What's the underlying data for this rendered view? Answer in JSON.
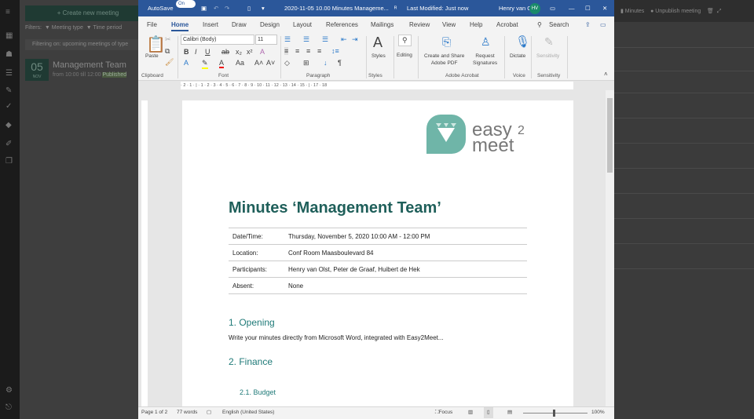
{
  "background_app": {
    "create_button": "+ Create new meeting",
    "filters_label": "Filters:",
    "filter_meeting_type": "▼ Meeting type",
    "filter_time_period": "▼ Time period",
    "filter_info": "Filtering on: upcoming meetings of type",
    "meeting": {
      "day": "05",
      "month": "NOV",
      "title": "Management Team",
      "subtitle": "from 10:00 till 12:00",
      "status": "Published"
    },
    "minutes_button": "Minutes",
    "unpublish_button": "Unpublish meeting"
  },
  "word": {
    "autosave": "AutoSave",
    "autosave_state": "On",
    "doc_title": "2020-11-05 10.00 Minutes Manageme...",
    "last_modified": "Last Modified: Just now",
    "user": "Henry van Olst",
    "initials": "HV",
    "tabs": [
      "File",
      "Home",
      "Insert",
      "Draw",
      "Design",
      "Layout",
      "References",
      "Mailings",
      "Review",
      "View",
      "Help",
      "Acrobat"
    ],
    "search": "Search",
    "font": "Calibri (Body)",
    "font_size": "11",
    "paste": "Paste",
    "styles": "Styles",
    "editing": "Editing",
    "create_share": "Create and Share",
    "adobe_pdf": "Adobe PDF",
    "request": "Request",
    "signatures": "Signatures",
    "dictate": "Dictate",
    "sensitivity": "Sensitivity",
    "groups": [
      "Clipboard",
      "Font",
      "Paragraph",
      "Styles",
      "Adobe Acrobat",
      "Voice",
      "Sensitivity"
    ],
    "ruler": "· 2 · 1 · | · 1 · 2 · 3 · 4 · 5 · 6 · 7 · 8 · 9 · 10 · 11 · 12 · 13 · 14 · 15 · | · 17 · 18",
    "status": {
      "page": "Page 1 of 2",
      "words": "77 words",
      "language": "English (United States)",
      "focus": "Focus",
      "zoom": "100%"
    }
  },
  "document": {
    "logo_line1": "easy2",
    "logo_line2": "meet",
    "title": "Minutes ‘Management Team’",
    "rows": [
      {
        "k": "Date/Time:",
        "v": "Thursday, November 5, 2020 10:00 AM - 12:00 PM"
      },
      {
        "k": "Location:",
        "v": "Conf Room Maasboulevard 84"
      },
      {
        "k": "Participants:",
        "v": "Henry van Olst, Peter de Graaf, Huibert de Hek"
      },
      {
        "k": "Absent:",
        "v": "None"
      }
    ],
    "h1": "1. Opening",
    "p1": "Write your minutes directly from Microsoft Word, integrated with Easy2Meet...",
    "h2": "2. Finance",
    "h3": "2.1. Budget"
  },
  "colors": {
    "word_blue": "#2b579a",
    "heading": "#1f5f5a",
    "brand": "#6fb5a8"
  }
}
